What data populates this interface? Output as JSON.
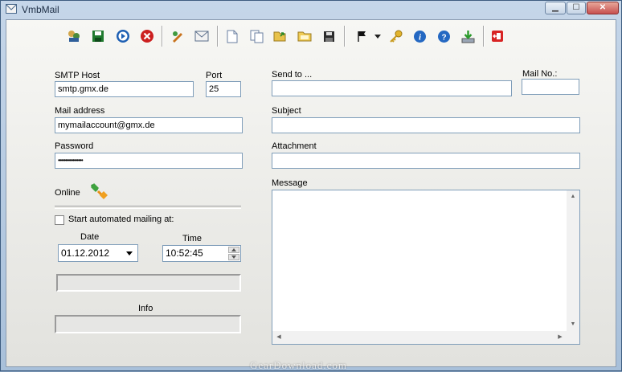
{
  "window": {
    "title": "VmbMail",
    "minimize": "▁",
    "maximize": "☐",
    "close": "✕"
  },
  "toolbar": {
    "buttons": [
      "contacts-icon",
      "save-icon",
      "play-icon",
      "stop-icon",
      "pen-icon",
      "envelope-icon",
      "new-icon",
      "copy-icon",
      "open-icon",
      "folder-icon",
      "disk-icon",
      "flag-icon",
      "key-icon",
      "info-icon",
      "help-icon",
      "download-icon",
      "exit-icon"
    ]
  },
  "smtp": {
    "host_label": "SMTP Host",
    "host_value": "smtp.gmx.de",
    "port_label": "Port",
    "port_value": "25"
  },
  "mail": {
    "label": "Mail address",
    "value": "mymailaccount@gmx.de"
  },
  "password": {
    "label": "Password",
    "value": "•••••••••••••••••"
  },
  "status": {
    "online_label": "Online"
  },
  "automation": {
    "checkbox_label": "Start automated mailing at:",
    "checked": false,
    "date_label": "Date",
    "date_value": "01.12.2012",
    "time_label": "Time",
    "time_value": "10:52:45"
  },
  "info": {
    "label": "Info"
  },
  "compose": {
    "send_to_label": "Send to ...",
    "mail_no_label": "Mail No.:",
    "subject_label": "Subject",
    "attachment_label": "Attachment",
    "message_label": "Message"
  },
  "watermark": "GearDownload.com"
}
